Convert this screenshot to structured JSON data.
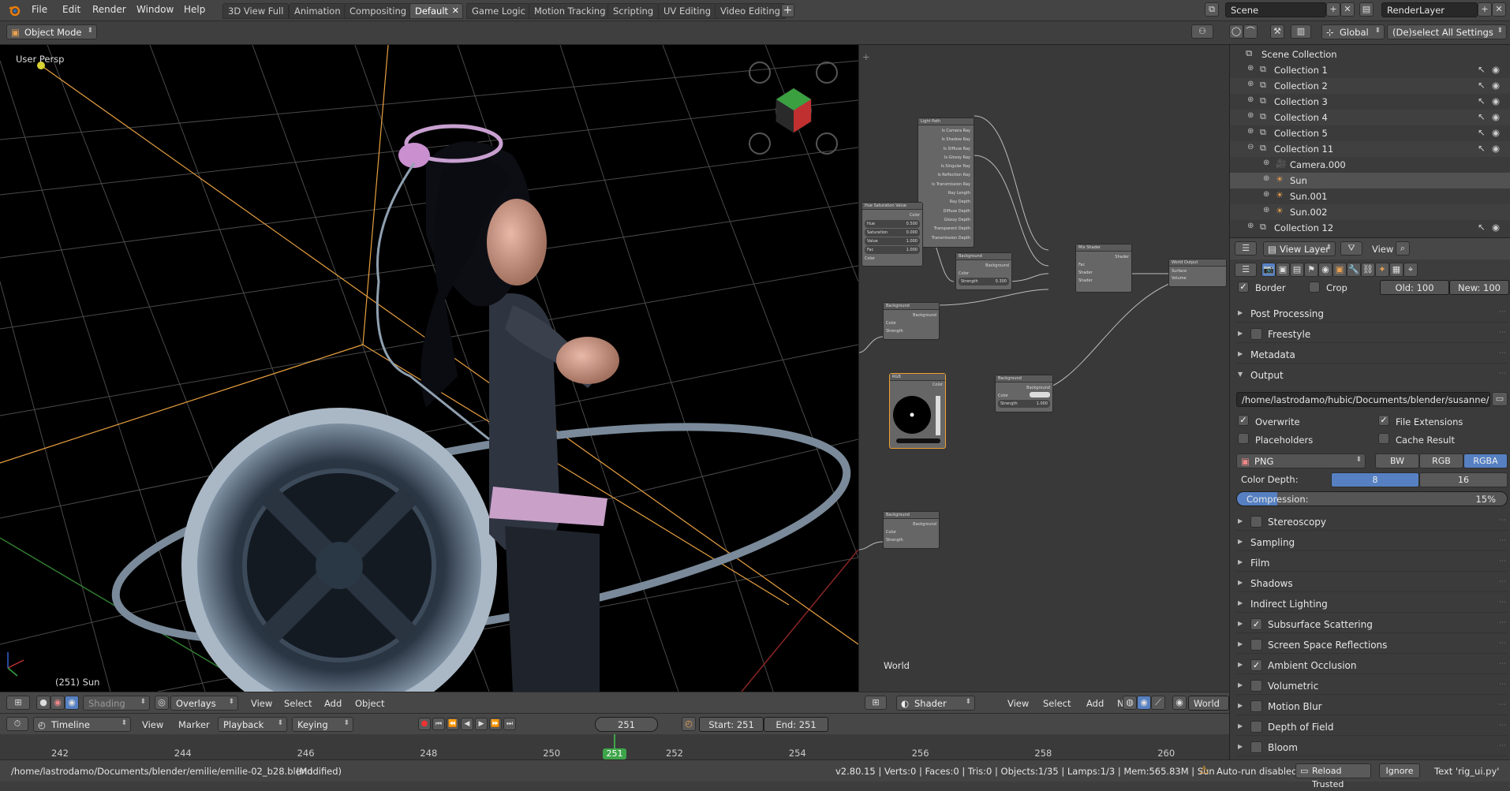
{
  "menu": {
    "items": [
      "File",
      "Edit",
      "Render",
      "Window",
      "Help"
    ]
  },
  "workspaces": {
    "tabs": [
      "3D View Full",
      "Animation",
      "Compositing",
      "Default",
      "Game Logic",
      "Motion Tracking",
      "Scripting",
      "UV Editing",
      "Video Editing"
    ],
    "active": "Default",
    "add_label": "+"
  },
  "scene": {
    "name": "Scene",
    "render_layer": "RenderLayer"
  },
  "header2": {
    "mode": "Object Mode",
    "orientation": "Global",
    "select_settings": "(De)select All Settings"
  },
  "viewport": {
    "label": "User Persp",
    "object_label": "(251) Sun",
    "header": {
      "shading": "Shading",
      "overlays": "Overlays",
      "menus": [
        "View",
        "Select",
        "Add",
        "Object"
      ]
    }
  },
  "nodes": {
    "world_label": "World",
    "header": {
      "type": "Shader",
      "menus": [
        "View",
        "Select",
        "Add",
        "Node"
      ],
      "world": "World"
    },
    "node_titles": {
      "light_path": "Light Path",
      "hsv": "Hue Saturation Value",
      "background_1": "Background",
      "background_2": "Background",
      "mix_shader": "Mix Shader",
      "world_output": "World Output",
      "rgb": "RGB",
      "background_3": "Background",
      "background_4": "Background"
    },
    "light_path_outputs": [
      "Is Camera Ray",
      "Is Shadow Ray",
      "Is Diffuse Ray",
      "Is Glossy Ray",
      "Is Singular Ray",
      "Is Reflection Ray",
      "Is Transmission Ray",
      "Ray Length",
      "Ray Depth",
      "Diffuse Depth",
      "Glossy Depth",
      "Transparent Depth",
      "Transmission Depth"
    ],
    "hsv_fields": [
      {
        "label": "Hue",
        "value": "0.500"
      },
      {
        "label": "Saturation",
        "value": "0.000"
      },
      {
        "label": "Value",
        "value": "1.000"
      },
      {
        "label": "Fac",
        "value": "1.000"
      }
    ],
    "background_strength_1": "0.300",
    "background_strength_3": "1.000"
  },
  "outliner": {
    "root": "Scene Collection",
    "rows": [
      {
        "name": "Collection 1"
      },
      {
        "name": "Collection 2"
      },
      {
        "name": "Collection 3"
      },
      {
        "name": "Collection 4"
      },
      {
        "name": "Collection 5"
      },
      {
        "name": "Collection 11"
      },
      {
        "name": "Camera.000"
      },
      {
        "name": "Sun"
      },
      {
        "name": "Sun.001"
      },
      {
        "name": "Sun.002"
      },
      {
        "name": "Collection 12"
      }
    ]
  },
  "props_header": {
    "view_layer": "View Layer",
    "view": "View"
  },
  "properties": {
    "border_label": "Border",
    "crop_label": "Crop",
    "old_label": "Old:",
    "old_value": "100",
    "new_label": "New:",
    "new_value": "100",
    "post_processing": "Post Processing",
    "freestyle": "Freestyle",
    "metadata": "Metadata",
    "output": "Output",
    "output_path": "/home/lastrodamo/hubic/Documents/blender/susanne/rendus/",
    "overwrite": "Overwrite",
    "file_extensions": "File Extensions",
    "placeholders": "Placeholders",
    "cache_result": "Cache Result",
    "format": "PNG",
    "color_modes": [
      "BW",
      "RGB",
      "RGBA"
    ],
    "color_mode_active": "RGBA",
    "color_depth_label": "Color Depth:",
    "color_depths": [
      "8",
      "16"
    ],
    "compression_label": "Compression:",
    "compression_value": "15%",
    "compression_fraction": 0.15,
    "panels": [
      {
        "label": "Stereoscopy",
        "checkbox": true,
        "checked": false
      },
      {
        "label": "Sampling",
        "checkbox": false
      },
      {
        "label": "Film",
        "checkbox": false
      },
      {
        "label": "Shadows",
        "checkbox": false
      },
      {
        "label": "Indirect Lighting",
        "checkbox": false
      },
      {
        "label": "Subsurface Scattering",
        "checkbox": true,
        "checked": true
      },
      {
        "label": "Screen Space Reflections",
        "checkbox": true,
        "checked": false
      },
      {
        "label": "Ambient Occlusion",
        "checkbox": true,
        "checked": true
      },
      {
        "label": "Volumetric",
        "checkbox": true,
        "checked": false
      },
      {
        "label": "Motion Blur",
        "checkbox": true,
        "checked": false
      },
      {
        "label": "Depth of Field",
        "checkbox": true,
        "checked": false
      },
      {
        "label": "Bloom",
        "checkbox": true,
        "checked": false
      }
    ]
  },
  "timeline": {
    "editor": "Timeline",
    "menus": [
      "View",
      "Marker"
    ],
    "playback": "Playback",
    "keying": "Keying",
    "current_frame": "251",
    "start_label": "Start:",
    "start": "251",
    "end_label": "End:",
    "end": "251",
    "ticks": [
      "242",
      "244",
      "246",
      "248",
      "250",
      "251",
      "252",
      "254",
      "256",
      "258",
      "260"
    ]
  },
  "status": {
    "file": "/home/lastrodamo/Documents/blender/emilie/emilie-02_b28.blend",
    "modified": "(Modified)",
    "stats": "v2.80.15 | Verts:0 | Faces:0 | Tris:0 | Objects:1/35 | Lamps:1/3 | Mem:565.83M | Sun",
    "autorun": "Auto-run disabled",
    "reload": "Reload Trusted",
    "ignore": "Ignore",
    "text_script": "Text 'rig_ui.py'"
  },
  "colors": {
    "accent": "#5680c2",
    "frame_marker": "#3fa54a",
    "selection_outline": "#f0a030"
  }
}
